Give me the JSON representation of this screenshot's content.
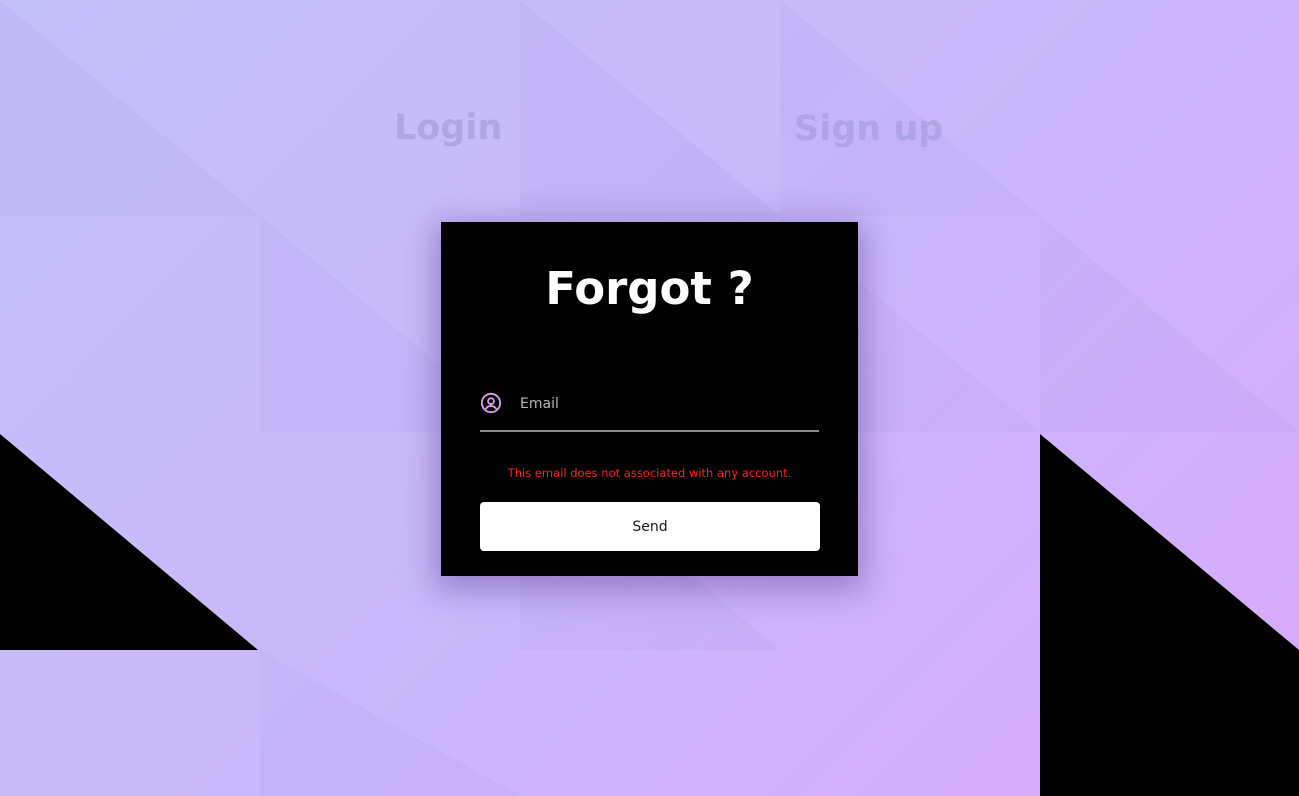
{
  "nav": {
    "login_label": "Login",
    "signup_label": "Sign up"
  },
  "forgot_form": {
    "title": "Forgot ?",
    "email_placeholder": "Email",
    "email_value": "",
    "error_message": "This email does not associated with any account.",
    "send_label": "Send"
  },
  "icons": {
    "email_field_icon": "user-circle-icon"
  },
  "colors": {
    "background_start": "#c4c0fa",
    "background_end": "#d9a9fb",
    "card_background": "#000000",
    "accent": "#d9a0f5",
    "error": "#ff1f1f",
    "button_background": "#ffffff"
  }
}
